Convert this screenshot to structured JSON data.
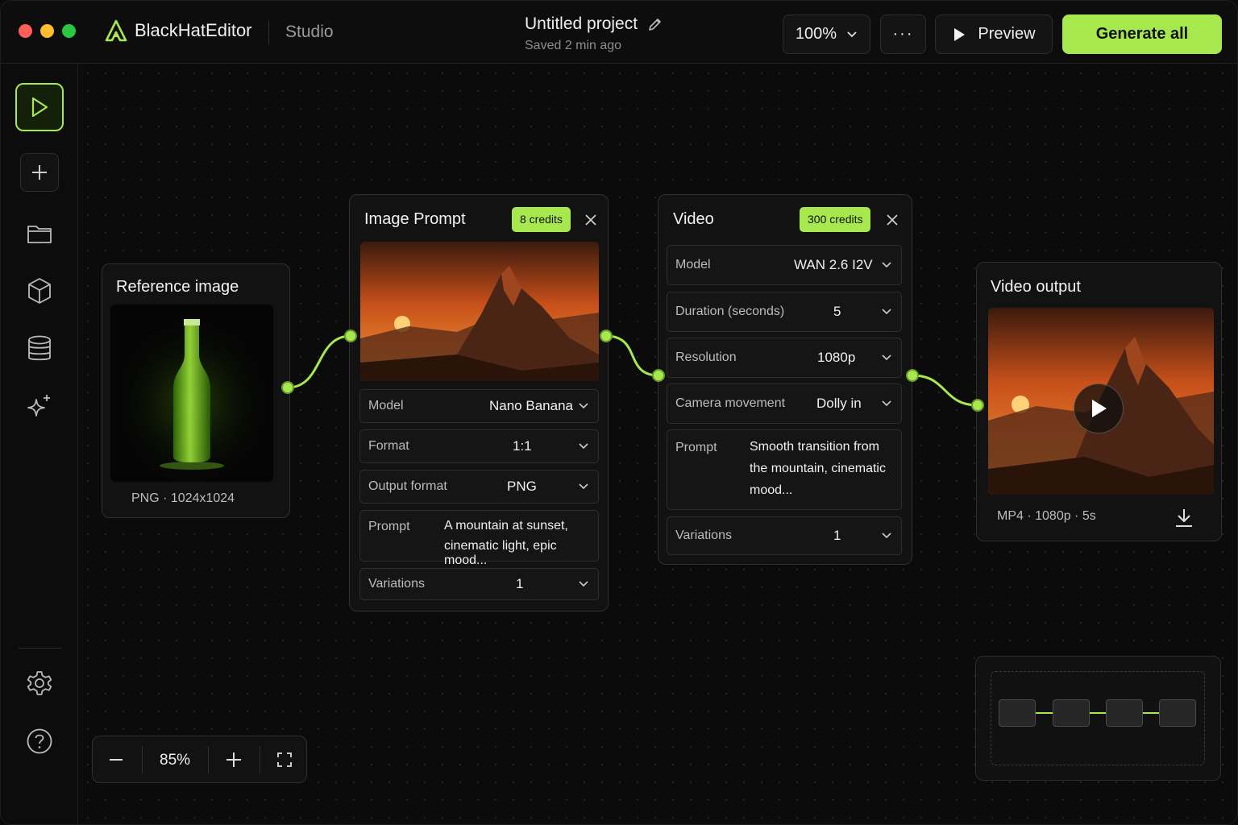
{
  "window": {
    "brand": "BlackHatEditor",
    "section": "Studio",
    "project_title": "Untitled project",
    "project_status": "Saved 2 min ago"
  },
  "toolbar": {
    "zoom": "100%",
    "more": "···",
    "preview": "Preview",
    "generate": "Generate all"
  },
  "sidebar": {
    "items": [
      "play-icon",
      "plus-icon",
      "folder-icon",
      "cube-icon",
      "database-icon",
      "sparkle-icon",
      "gear-icon",
      "help-icon"
    ]
  },
  "nodes": {
    "reference": {
      "title": "Reference image",
      "meta": "PNG · 1024x1024"
    },
    "image_prompt": {
      "title": "Image Prompt",
      "credits": "8 credits",
      "fields": [
        {
          "label": "Model",
          "value": "Nano Banana"
        },
        {
          "label": "Format",
          "value": "1:1"
        },
        {
          "label": "Output format",
          "value": "PNG"
        }
      ],
      "prompt_label": "Prompt",
      "prompt_line1": "A mountain at sunset,",
      "prompt_line2": "cinematic light, epic mood...",
      "variations_label": "Variations",
      "variations_value": "1"
    },
    "video": {
      "title": "Video",
      "credits": "300 credits",
      "fields": [
        {
          "label": "Model",
          "value": "WAN 2.6 I2V"
        },
        {
          "label": "Duration (seconds)",
          "value": "5"
        },
        {
          "label": "Resolution",
          "value": "1080p"
        },
        {
          "label": "Camera movement",
          "value": "Dolly in"
        }
      ],
      "prompt_label": "Prompt",
      "prompt_line1": "Smooth transition from",
      "prompt_line2": "the mountain, cinematic",
      "prompt_line3": "mood...",
      "variations_label": "Variations",
      "variations_value": "1"
    },
    "output": {
      "title": "Video output",
      "meta": "MP4 · 1080p · 5s"
    }
  },
  "zoom_controls": {
    "level": "85%"
  },
  "colors": {
    "accent": "#a7e84f",
    "background": "#0b0b0b",
    "panel": "#121212"
  }
}
